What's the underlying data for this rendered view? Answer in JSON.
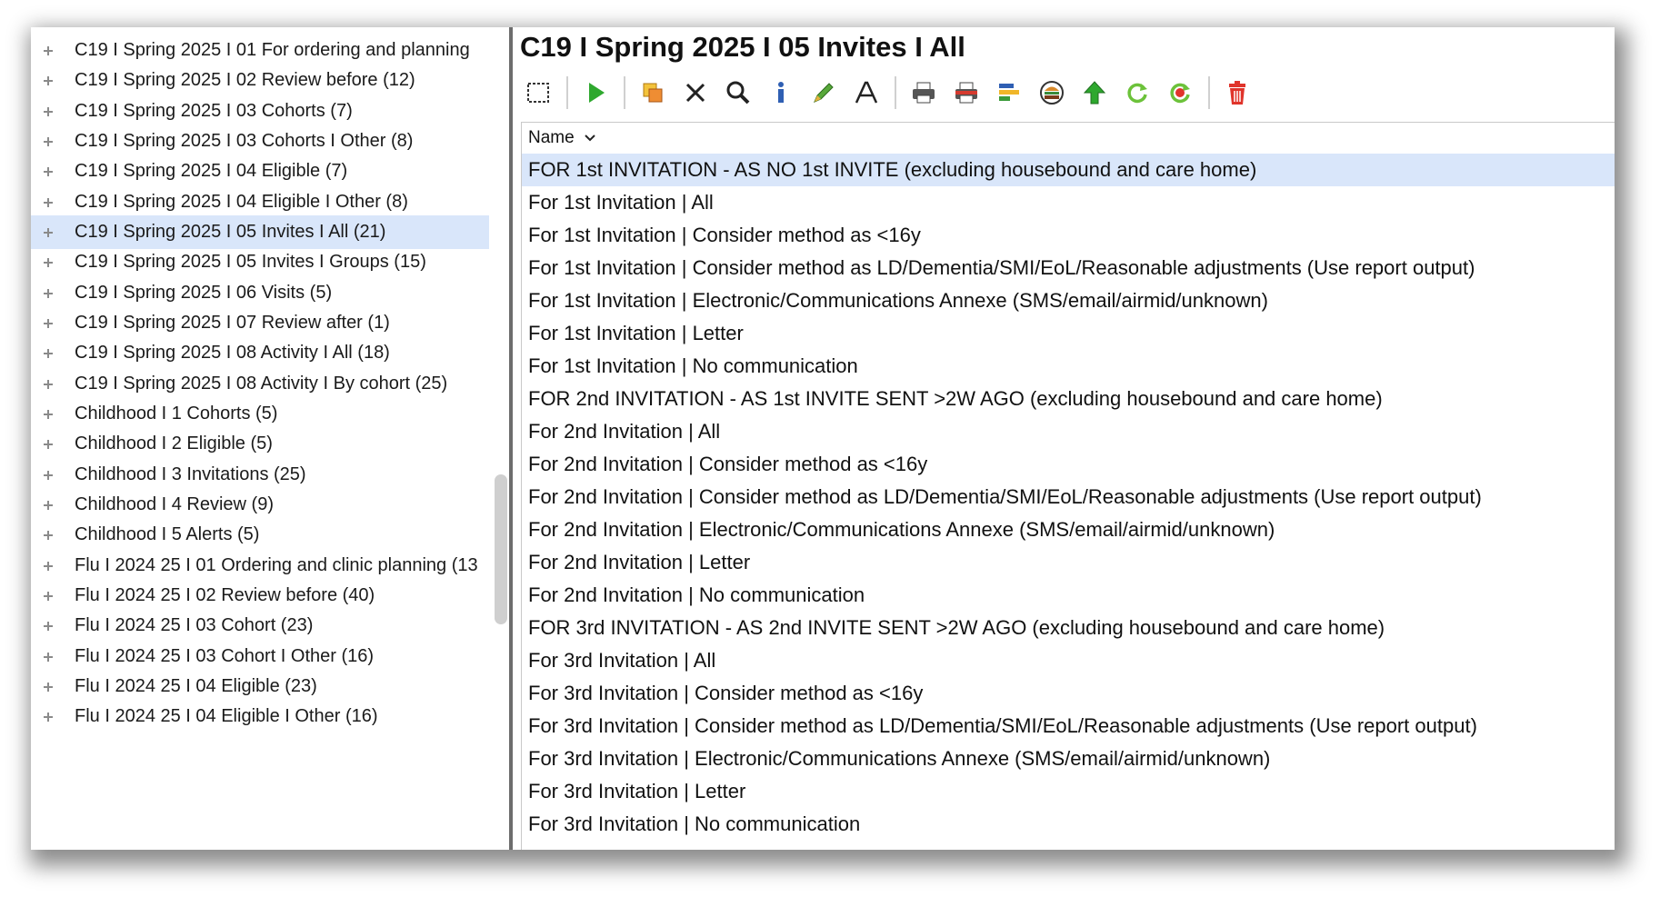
{
  "tree": {
    "items": [
      {
        "label": "C19 I Spring 2025 I 01 For ordering and planning",
        "selected": false
      },
      {
        "label": "C19 I Spring 2025 I 02 Review before (12)",
        "selected": false
      },
      {
        "label": "C19 I Spring 2025 I 03 Cohorts (7)",
        "selected": false
      },
      {
        "label": "C19 I Spring 2025 I 03 Cohorts I Other (8)",
        "selected": false
      },
      {
        "label": "C19 I Spring 2025 I 04 Eligible (7)",
        "selected": false
      },
      {
        "label": "C19 I Spring 2025 I 04 Eligible I Other (8)",
        "selected": false
      },
      {
        "label": "C19 I Spring 2025 I 05 Invites I All (21)",
        "selected": true
      },
      {
        "label": "C19 I Spring 2025 I 05 Invites I Groups (15)",
        "selected": false
      },
      {
        "label": "C19 I Spring 2025 I 06 Visits (5)",
        "selected": false
      },
      {
        "label": "C19 I Spring 2025 I 07 Review after (1)",
        "selected": false
      },
      {
        "label": "C19 I Spring 2025 I 08 Activity I All (18)",
        "selected": false
      },
      {
        "label": "C19 I Spring 2025 I 08 Activity I By cohort (25)",
        "selected": false
      },
      {
        "label": "Childhood I 1 Cohorts (5)",
        "selected": false
      },
      {
        "label": "Childhood I 2 Eligible (5)",
        "selected": false
      },
      {
        "label": "Childhood I 3 Invitations (25)",
        "selected": false
      },
      {
        "label": "Childhood I 4 Review (9)",
        "selected": false
      },
      {
        "label": "Childhood I 5 Alerts (5)",
        "selected": false
      },
      {
        "label": "Flu I 2024 25 I 01 Ordering and clinic planning (13",
        "selected": false
      },
      {
        "label": "Flu I 2024 25 I 02 Review before (40)",
        "selected": false
      },
      {
        "label": "Flu I 2024 25 I 03 Cohort (23)",
        "selected": false
      },
      {
        "label": "Flu I 2024 25 I 03 Cohort I Other (16)",
        "selected": false
      },
      {
        "label": "Flu I 2024 25 I 04 Eligible (23)",
        "selected": false
      },
      {
        "label": "Flu I 2024 25 I 04 Eligible I Other (16)",
        "selected": false
      }
    ]
  },
  "main": {
    "title": "C19 I Spring 2025 I 05 Invites I All",
    "toolbar": [
      {
        "name": "select-all-icon",
        "sep_after": true
      },
      {
        "name": "run-icon",
        "sep_after": true
      },
      {
        "name": "copy-icon",
        "sep_after": false
      },
      {
        "name": "delete-x-icon",
        "sep_after": false
      },
      {
        "name": "search-icon",
        "sep_after": false
      },
      {
        "name": "info-icon",
        "sep_after": false
      },
      {
        "name": "edit-pencil-icon",
        "sep_after": false
      },
      {
        "name": "rename-text-icon",
        "sep_after": true
      },
      {
        "name": "print-icon",
        "sep_after": false
      },
      {
        "name": "print-red-icon",
        "sep_after": false
      },
      {
        "name": "report-icon",
        "sep_after": false
      },
      {
        "name": "burger-icon",
        "sep_after": false
      },
      {
        "name": "upload-arrow-icon",
        "sep_after": false
      },
      {
        "name": "refresh-icon",
        "sep_after": false
      },
      {
        "name": "refresh-red-icon",
        "sep_after": true
      },
      {
        "name": "trash-icon",
        "sep_after": false
      }
    ],
    "column_header": "Name",
    "rows": [
      {
        "label": "FOR 1st INVITATION - AS NO 1st INVITE (excluding housebound and care home)",
        "selected": true
      },
      {
        "label": "For 1st Invitation | All",
        "selected": false
      },
      {
        "label": "For 1st Invitation | Consider method as <16y",
        "selected": false
      },
      {
        "label": "For 1st Invitation | Consider method as LD/Dementia/SMI/EoL/Reasonable adjustments (Use report output)",
        "selected": false
      },
      {
        "label": "For 1st Invitation | Electronic/Communications Annexe (SMS/email/airmid/unknown)",
        "selected": false
      },
      {
        "label": "For 1st Invitation | Letter",
        "selected": false
      },
      {
        "label": "For 1st Invitation | No communication",
        "selected": false
      },
      {
        "label": "FOR 2nd INVITATION - AS 1st INVITE SENT >2W AGO (excluding housebound and care home)",
        "selected": false
      },
      {
        "label": "For 2nd Invitation | All",
        "selected": false
      },
      {
        "label": "For 2nd Invitation | Consider method as <16y",
        "selected": false
      },
      {
        "label": "For 2nd Invitation | Consider method as LD/Dementia/SMI/EoL/Reasonable adjustments (Use report output)",
        "selected": false
      },
      {
        "label": "For 2nd Invitation | Electronic/Communications Annexe (SMS/email/airmid/unknown)",
        "selected": false
      },
      {
        "label": "For 2nd Invitation | Letter",
        "selected": false
      },
      {
        "label": "For 2nd Invitation | No communication",
        "selected": false
      },
      {
        "label": "FOR 3rd INVITATION - AS 2nd INVITE SENT >2W AGO (excluding housebound and care home)",
        "selected": false
      },
      {
        "label": "For 3rd Invitation | All",
        "selected": false
      },
      {
        "label": "For 3rd Invitation | Consider method as <16y",
        "selected": false
      },
      {
        "label": "For 3rd Invitation | Consider method as LD/Dementia/SMI/EoL/Reasonable adjustments (Use report output)",
        "selected": false
      },
      {
        "label": "For 3rd Invitation | Electronic/Communications Annexe (SMS/email/airmid/unknown)",
        "selected": false
      },
      {
        "label": "For 3rd Invitation | Letter",
        "selected": false
      },
      {
        "label": "For 3rd Invitation | No communication",
        "selected": false
      }
    ]
  },
  "colors": {
    "selection": "#d9e6fa",
    "splitter": "#6d6d6d",
    "run_green": "#2ea82e",
    "delete_red": "#e0342b"
  }
}
